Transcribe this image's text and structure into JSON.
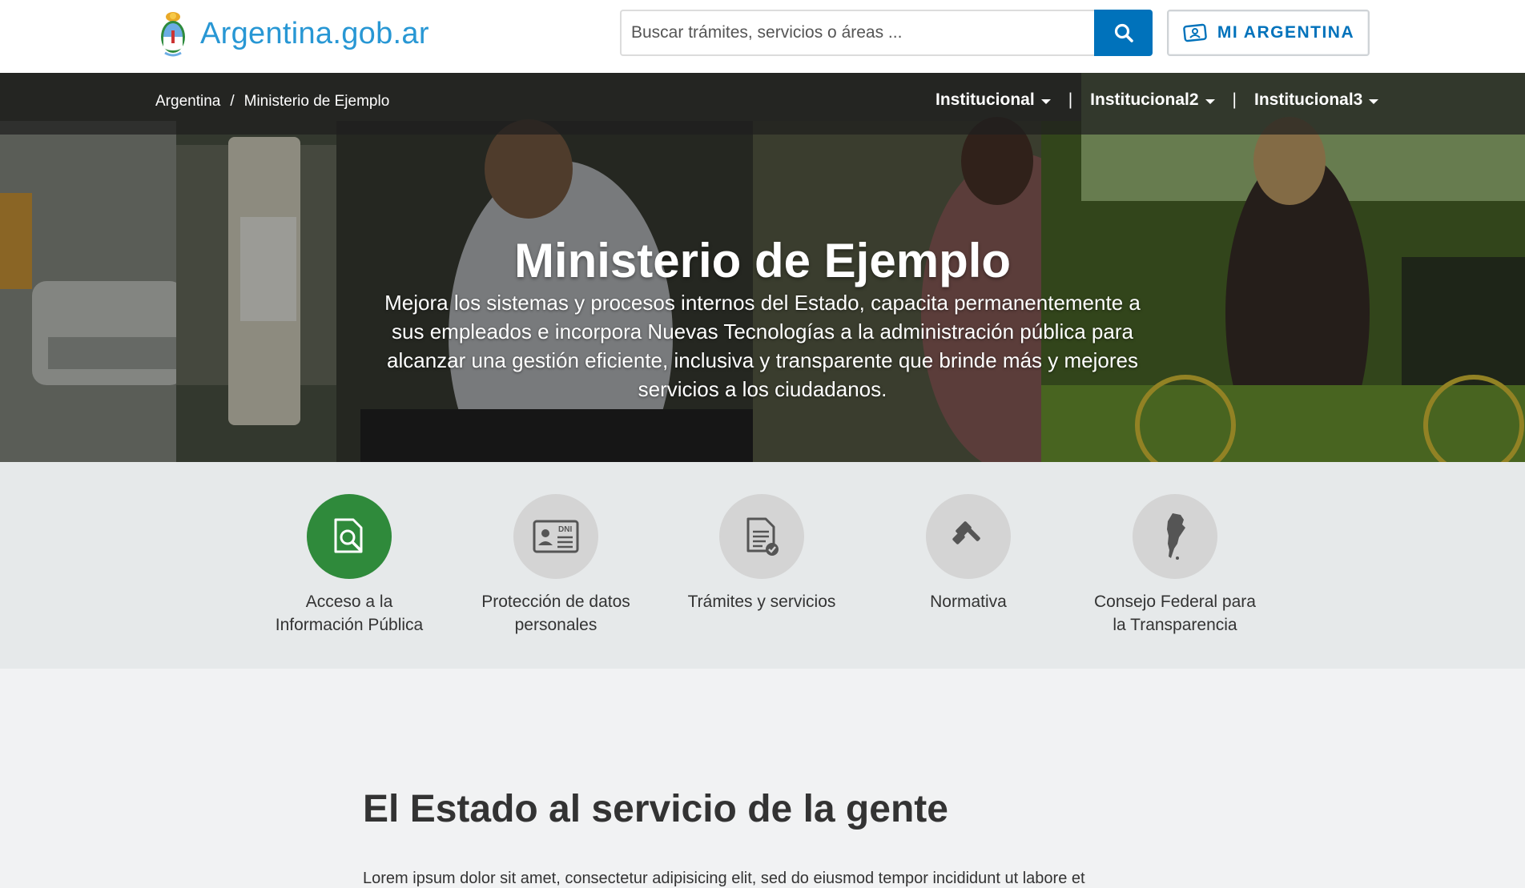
{
  "header": {
    "logo_text": "Argentina.gob.ar",
    "search_placeholder": "Buscar trámites, servicios o áreas ...",
    "mi_argentina_label": "MI ARGENTINA"
  },
  "breadcrumb": {
    "home": "Argentina",
    "separator": "/",
    "current": "Ministerio de Ejemplo"
  },
  "nav": {
    "items": [
      "Institucional",
      "Institucional2",
      "Institucional3"
    ],
    "separator": "|"
  },
  "hero": {
    "title": "Ministerio de Ejemplo",
    "description": "Mejora los sistemas y procesos internos del Estado, capacita permanentemente a sus empleados e incorpora Nuevas Tecnologías a la administración pública para alcanzar una gestión eficiente, inclusiva y transparente que brinde más y mejores servicios a los ciudadanos."
  },
  "quick_access": [
    {
      "label": "Acceso a la Información Pública",
      "icon": "document-search-icon",
      "active": true
    },
    {
      "label": "Protección de datos personales",
      "icon": "dni-card-icon",
      "active": false
    },
    {
      "label": "Trámites y servicios",
      "icon": "document-check-icon",
      "active": false
    },
    {
      "label": "Normativa",
      "icon": "gavel-icon",
      "active": false
    },
    {
      "label": "Consejo Federal para la Transparencia",
      "icon": "argentina-map-icon",
      "active": false
    }
  ],
  "content": {
    "title": "El Estado al servicio de la gente",
    "text": "Lorem ipsum dolor sit amet, consectetur adipisicing elit, sed do eiusmod tempor incididunt ut labore et"
  },
  "colors": {
    "brand_blue": "#0072bb",
    "logo_blue": "#2897d4",
    "active_green": "#2f8a3b"
  }
}
